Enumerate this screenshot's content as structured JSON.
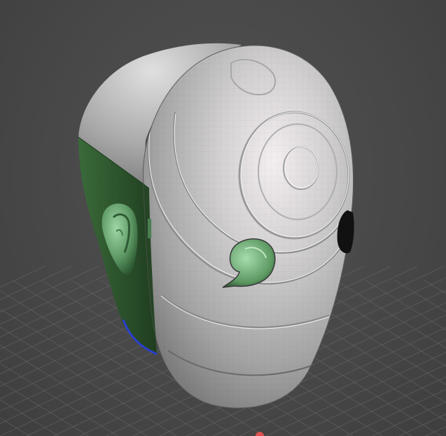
{
  "viewport": {
    "background_color": "#4a4a4a",
    "grid_color": "#6a6a6a"
  },
  "model": {
    "mesh_color": "#c4c4c4",
    "mesh_shadow_color": "#8d8d8d",
    "mesh_highlight_color": "#f4eef0",
    "backface_color": "#2f5a2f",
    "backface_highlight_color": "#79b980",
    "edge_accent_color": "#2a3fd0"
  },
  "indicators": {
    "origin_marker_color": "#e05050"
  }
}
